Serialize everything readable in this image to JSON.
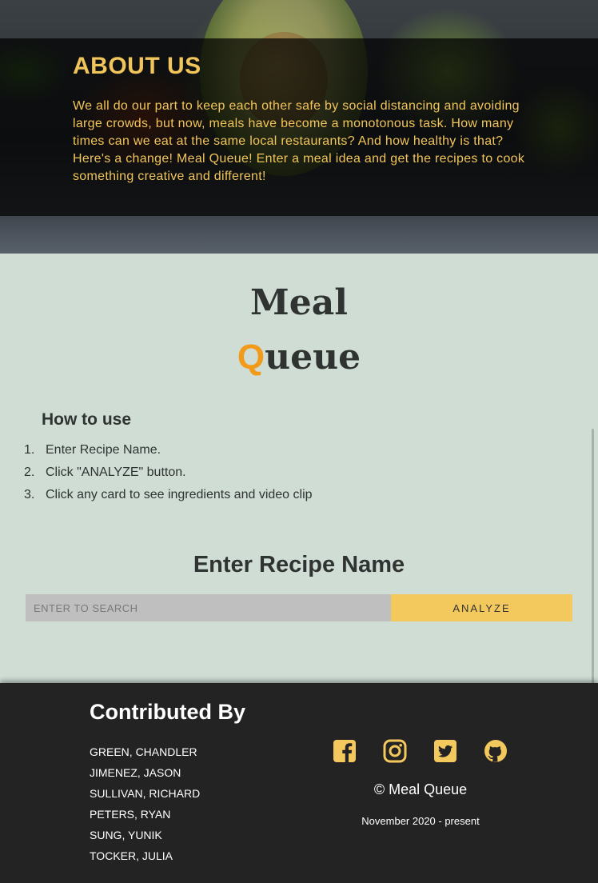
{
  "about": {
    "title": "ABOUT US",
    "text": "We all do our part to keep each other safe by social distancing and avoiding large crowds, but now, meals have become a monotonous task. How many times can we eat at the same local restaurants? And how healthy is that? Here's a change! Meal Queue! Enter a meal idea and get the recipes to cook something creative and different!"
  },
  "brand": {
    "line1": "Meal",
    "line2_first": "Q",
    "line2_rest": "ueue",
    "accent_color": "#f29a1a"
  },
  "how_to_use": {
    "title": "How to use",
    "steps": [
      {
        "num": "1.",
        "text": "Enter Recipe Name."
      },
      {
        "num": "2.",
        "text": "Click \"ANALYZE\" button."
      },
      {
        "num": "3.",
        "text": "Click any card to see ingredients and video clip"
      }
    ]
  },
  "search": {
    "title": "Enter Recipe Name",
    "placeholder": "ENTER TO SEARCH",
    "button_label": "ANALYZE"
  },
  "footer": {
    "contrib_title": "Contributed By",
    "contributors": [
      "GREEN, CHANDLER",
      "JIMENEZ, JASON",
      "SULLIVAN, RICHARD",
      "PETERS, RYAN",
      "SUNG, YUNIK",
      "TOCKER, JULIA"
    ],
    "social_icons": [
      "facebook-icon",
      "instagram-icon",
      "twitter-icon",
      "github-icon"
    ],
    "copyright": "© Meal Queue",
    "since": "November 2020 - present",
    "icon_color": "#f3c95e"
  },
  "colors": {
    "gold": "#f2c55a",
    "main_bg": "#cfddd5",
    "footer_bg": "#232323",
    "button_bg": "#f3c95e"
  }
}
